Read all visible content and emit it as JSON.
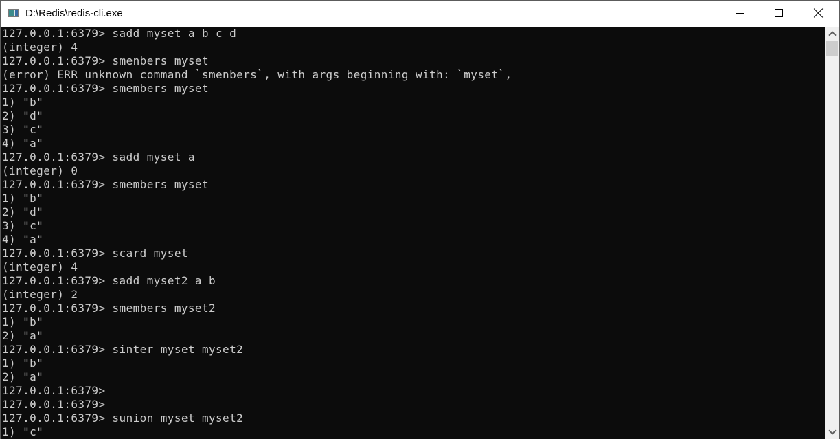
{
  "window": {
    "title": "D:\\Redis\\redis-cli.exe",
    "icon": "console-app-icon",
    "controls": {
      "minimize": "minimize-icon",
      "maximize": "maximize-icon",
      "close": "close-icon"
    }
  },
  "console": {
    "lines": [
      "127.0.0.1:6379> sadd myset a b c d",
      "(integer) 4",
      "127.0.0.1:6379> smenbers myset",
      "(error) ERR unknown command `smenbers`, with args beginning with: `myset`,",
      "127.0.0.1:6379> smembers myset",
      "1) \"b\"",
      "2) \"d\"",
      "3) \"c\"",
      "4) \"a\"",
      "127.0.0.1:6379> sadd myset a",
      "(integer) 0",
      "127.0.0.1:6379> smembers myset",
      "1) \"b\"",
      "2) \"d\"",
      "3) \"c\"",
      "4) \"a\"",
      "127.0.0.1:6379> scard myset",
      "(integer) 4",
      "127.0.0.1:6379> sadd myset2 a b",
      "(integer) 2",
      "127.0.0.1:6379> smembers myset2",
      "1) \"b\"",
      "2) \"a\"",
      "127.0.0.1:6379> sinter myset myset2",
      "1) \"b\"",
      "2) \"a\"",
      "127.0.0.1:6379>",
      "127.0.0.1:6379>",
      "127.0.0.1:6379> sunion myset myset2",
      "1) \"c\""
    ]
  },
  "scrollbar": {
    "up": "chevron-up-icon",
    "down": "chevron-down-icon"
  }
}
